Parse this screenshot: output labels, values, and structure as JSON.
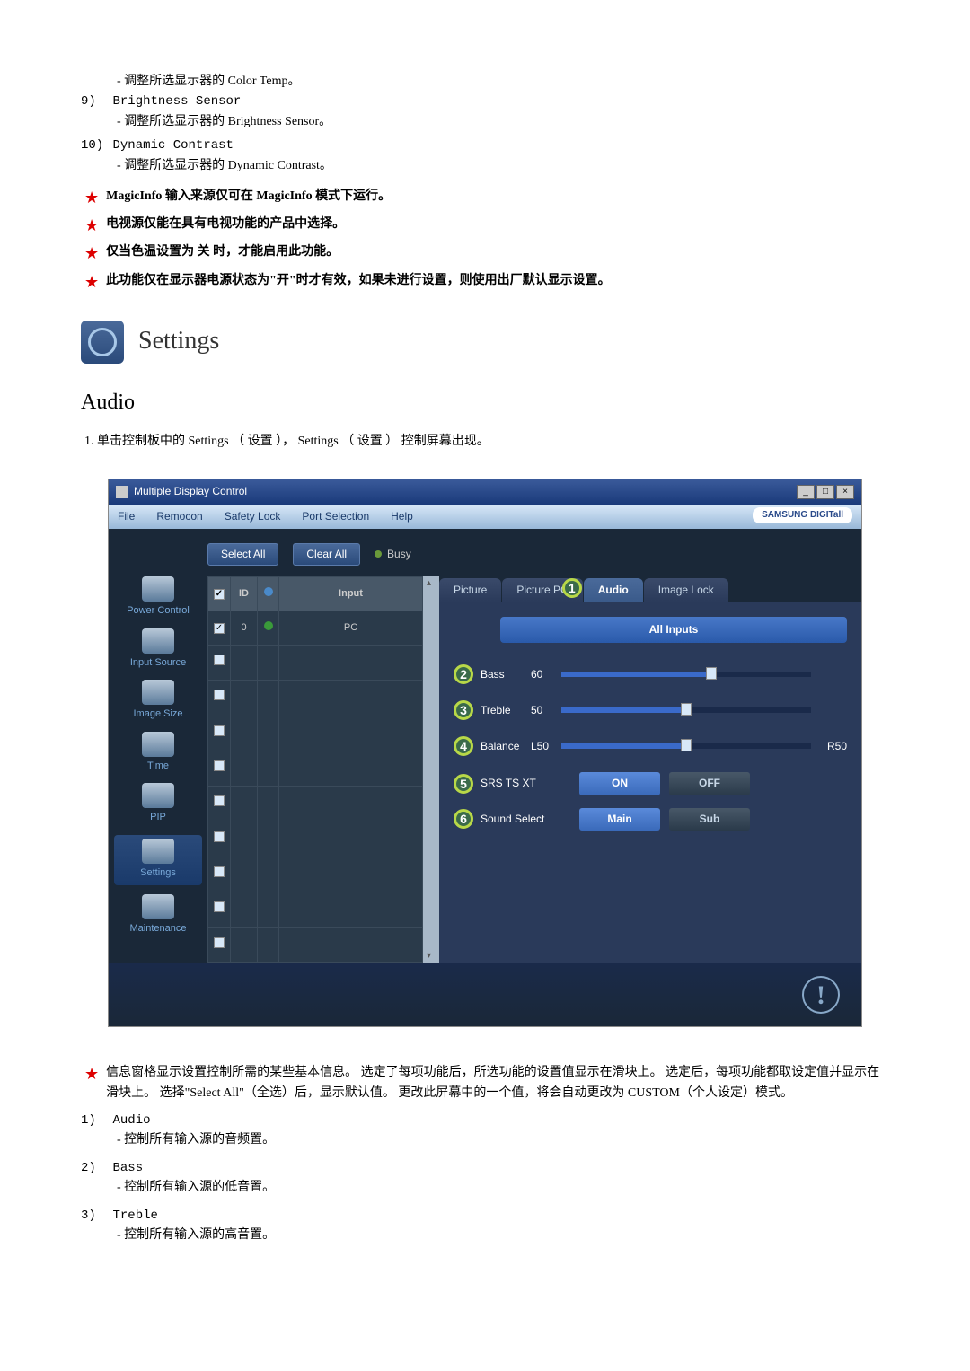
{
  "top_list": [
    {
      "desc": "- 调整所选显示器的 Color Temp。"
    },
    {
      "num": "9)",
      "title": "Brightness Sensor",
      "desc": "- 调整所选显示器的 Brightness Sensor。"
    },
    {
      "num": "10)",
      "title": "Dynamic Contrast",
      "desc": "- 调整所选显示器的 Dynamic Contrast。"
    }
  ],
  "star_notes_top": [
    "MagicInfo 输入来源仅可在 MagicInfo 模式下运行。",
    "电视源仅能在具有电视功能的产品中选择。",
    "仅当色温设置为 关 时，才能启用此功能。",
    "此功能仅在显示器电源状态为\"开\"时才有效，如果未进行设置，则使用出厂默认显示设置。"
  ],
  "settings_heading": "Settings",
  "audio_heading": "Audio",
  "step1": "1. 单击控制板中的 Settings （ 设置 ）， Settings （ 设置 ） 控制屏幕出现。",
  "app": {
    "title": "Multiple Display Control",
    "menu": [
      "File",
      "Remocon",
      "Safety Lock",
      "Port Selection",
      "Help"
    ],
    "brand": "SAMSUNG DIGITall",
    "toolbar": {
      "select_all": "Select All",
      "clear_all": "Clear All",
      "busy": "Busy"
    },
    "sidebar": [
      "Power Control",
      "Input Source",
      "Image Size",
      "Time",
      "PIP",
      "Settings",
      "Maintenance"
    ],
    "grid": {
      "headers": {
        "cb": "☑",
        "id": "ID",
        "st": "●",
        "input": "Input"
      },
      "row0": {
        "id": "0",
        "input": "PC"
      }
    },
    "tabs": [
      "Picture",
      "Picture PC",
      "Audio",
      "Image Lock"
    ],
    "all_inputs": "All Inputs",
    "sliders": [
      {
        "n": "2",
        "label": "Bass",
        "val": "60",
        "pos": 60,
        "tail": ""
      },
      {
        "n": "3",
        "label": "Treble",
        "val": "50",
        "pos": 50,
        "tail": ""
      },
      {
        "n": "4",
        "label": "Balance",
        "val": "L50",
        "pos": 50,
        "tail": "R50"
      }
    ],
    "btn_rows": [
      {
        "n": "5",
        "label": "SRS TS XT",
        "on": "ON",
        "off": "OFF"
      },
      {
        "n": "6",
        "label": "Sound Select",
        "on": "Main",
        "off": "Sub"
      }
    ],
    "info": "!"
  },
  "star_notes_bottom": [
    "信息窗格显示设置控制所需的某些基本信息。 选定了每项功能后，所选功能的设置值显示在滑块上。 选定后，每项功能都取设定值并显示在滑块上。 选择\"Select All\"（全选）后，显示默认值。 更改此屏幕中的一个值，将会自动更改为 CUSTOM（个人设定）模式。"
  ],
  "num_list_bottom": [
    {
      "num": "1)",
      "title": "Audio",
      "desc": "- 控制所有输入源的音频置。"
    },
    {
      "num": "2)",
      "title": "Bass",
      "desc": "- 控制所有输入源的低音置。"
    },
    {
      "num": "3)",
      "title": "Treble",
      "desc": "- 控制所有输入源的高音置。"
    }
  ]
}
